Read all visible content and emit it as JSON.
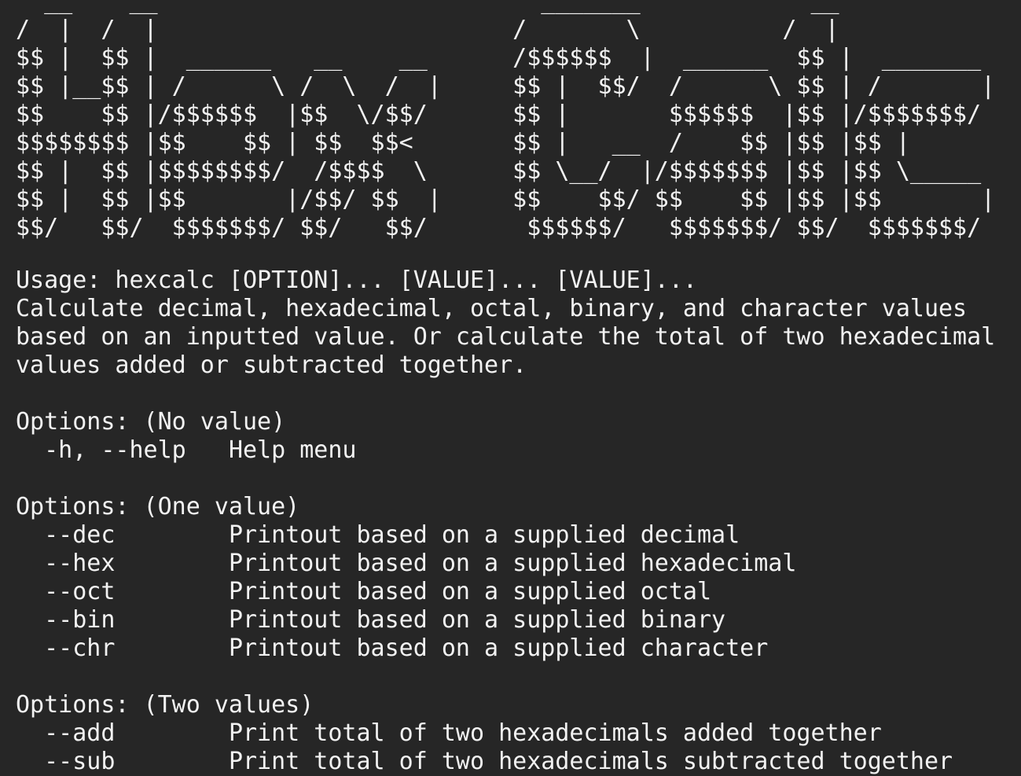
{
  "banner": [
    "  __    __                           _______            __",
    "/  |  /  |                         /       \\          /  |",
    "$$ |  $$ |  ______   __    __      /$$$$$$  |  ______  $$ |  _______",
    "$$ |__$$ | /      \\ /  \\  /  |     $$ |  $$/  /      \\ $$ | /       |",
    "$$    $$ |/$$$$$$  |$$  \\/$$/      $$ |       $$$$$$  |$$ |/$$$$$$$/",
    "$$$$$$$$ |$$    $$ | $$  $$<       $$ |   __  /    $$ |$$ |$$ |",
    "$$ |  $$ |$$$$$$$$/  /$$$$  \\      $$ \\__/  |/$$$$$$$ |$$ |$$ \\_____",
    "$$ |  $$ |$$       |/$$/ $$  |     $$    $$/ $$    $$ |$$ |$$       |",
    "$$/   $$/  $$$$$$$/ $$/   $$/       $$$$$$/   $$$$$$$/ $$/  $$$$$$$/"
  ],
  "usage": {
    "line": "Usage: hexcalc [OPTION]... [VALUE]... [VALUE]...",
    "description": [
      "Calculate decimal, hexadecimal, octal, binary, and character values",
      "based on an inputted value. Or calculate the total of two hexadecimal",
      "values added or subtracted together."
    ]
  },
  "sections": [
    {
      "heading": "Options: (No value)",
      "options": [
        {
          "flag": "  -h, --help   ",
          "desc": "Help menu"
        }
      ]
    },
    {
      "heading": "Options: (One value)",
      "options": [
        {
          "flag": "  --dec        ",
          "desc": "Printout based on a supplied decimal"
        },
        {
          "flag": "  --hex        ",
          "desc": "Printout based on a supplied hexadecimal"
        },
        {
          "flag": "  --oct        ",
          "desc": "Printout based on a supplied octal"
        },
        {
          "flag": "  --bin        ",
          "desc": "Printout based on a supplied binary"
        },
        {
          "flag": "  --chr        ",
          "desc": "Printout based on a supplied character"
        }
      ]
    },
    {
      "heading": "Options: (Two values)",
      "options": [
        {
          "flag": "  --add        ",
          "desc": "Print total of two hexadecimals added together"
        },
        {
          "flag": "  --sub        ",
          "desc": "Print total of two hexadecimals subtracted together"
        }
      ]
    }
  ]
}
